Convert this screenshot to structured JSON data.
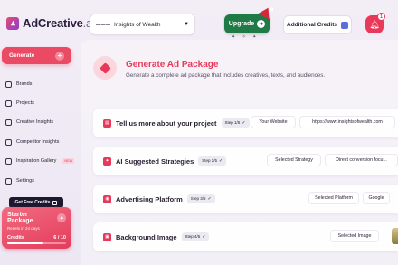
{
  "app": {
    "logo_text": "AdCreative",
    "logo_suffix": ".ai"
  },
  "header": {
    "project": "Insights of Wealth",
    "upgrade_label": "Upgrade",
    "credits_label": "Additional Credits",
    "notifications_count": "1"
  },
  "sidebar": {
    "generate_label": "Generate",
    "items": [
      {
        "label": "Brands",
        "icon": "brands-icon"
      },
      {
        "label": "Projects",
        "icon": "projects-icon"
      },
      {
        "label": "Creative Insights",
        "icon": "insights-icon"
      },
      {
        "label": "Competitor Insights",
        "icon": "competitor-icon"
      },
      {
        "label": "Inspiration Gallery",
        "icon": "gallery-icon",
        "badge": "NEW"
      },
      {
        "label": "Settings",
        "icon": "gear-icon"
      }
    ],
    "free_credits_label": "Get Free Credits",
    "plan": {
      "name": "Starter Package",
      "reset": "Resets in 24 days",
      "credits_label": "Credits",
      "credits_used": 6,
      "credits_total": 10,
      "credits_text": "6 / 10",
      "progress": 0.6
    }
  },
  "main": {
    "title": "Generate Ad Package",
    "subtitle": "Generate a complete ad package that includes creatives, texts, and audiences.",
    "steps": [
      {
        "title": "Tell us more about your project",
        "step": "Step 1/5",
        "chips": [
          "Your Website",
          "https://www.insightsofwealth.com"
        ]
      },
      {
        "title": "AI Suggested Strategies",
        "step": "Step 2/5",
        "chips": [
          "Selected Strategy",
          "Direct conversion focu..."
        ]
      },
      {
        "title": "Advertising Platform",
        "step": "Step 3/5",
        "chips": [
          "Selected Platform",
          "Google"
        ]
      },
      {
        "title": "Background Image",
        "step": "Step 4/5",
        "chips": [
          "Selected Image"
        ]
      }
    ]
  },
  "colors": {
    "accent": "#e8395a",
    "upgrade": "#1f7a45",
    "dark": "#1d1830"
  }
}
